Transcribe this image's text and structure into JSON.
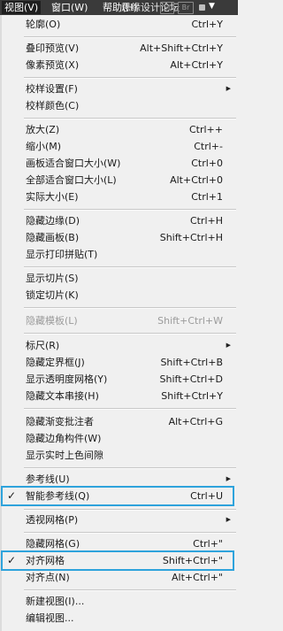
{
  "menubar": {
    "view": "视图(V)",
    "window": "窗口(W)",
    "help": "帮助(H)",
    "watermark": "思缘设计论坛",
    "icon_st": "St",
    "icon_br": "Br"
  },
  "colors": {
    "menubar_bg": "#3a3a3a",
    "menu_bg": "#f0f0f0",
    "highlight": "#2ea3dc"
  },
  "menu": {
    "items": [
      {
        "label": "轮廓(O)",
        "shortcut": "Ctrl+Y"
      },
      {
        "label": "叠印预览(V)",
        "shortcut": "Alt+Shift+Ctrl+Y"
      },
      {
        "label": "像素预览(X)",
        "shortcut": "Alt+Ctrl+Y"
      },
      {
        "label": "校样设置(F)",
        "shortcut": ""
      },
      {
        "label": "校样颜色(C)",
        "shortcut": ""
      },
      {
        "label": "放大(Z)",
        "shortcut": "Ctrl++"
      },
      {
        "label": "缩小(M)",
        "shortcut": "Ctrl+-"
      },
      {
        "label": "画板适合窗口大小(W)",
        "shortcut": "Ctrl+0"
      },
      {
        "label": "全部适合窗口大小(L)",
        "shortcut": "Alt+Ctrl+0"
      },
      {
        "label": "实际大小(E)",
        "shortcut": "Ctrl+1"
      },
      {
        "label": "隐藏边缘(D)",
        "shortcut": "Ctrl+H"
      },
      {
        "label": "隐藏画板(B)",
        "shortcut": "Shift+Ctrl+H"
      },
      {
        "label": "显示打印拼贴(T)",
        "shortcut": ""
      },
      {
        "label": "显示切片(S)",
        "shortcut": ""
      },
      {
        "label": "锁定切片(K)",
        "shortcut": ""
      },
      {
        "label": "隐藏模板(L)",
        "shortcut": "Shift+Ctrl+W"
      },
      {
        "label": "标尺(R)",
        "shortcut": ""
      },
      {
        "label": "隐藏定界框(J)",
        "shortcut": "Shift+Ctrl+B"
      },
      {
        "label": "显示透明度网格(Y)",
        "shortcut": "Shift+Ctrl+D"
      },
      {
        "label": "隐藏文本串接(H)",
        "shortcut": "Shift+Ctrl+Y"
      },
      {
        "label": "隐藏渐变批注者",
        "shortcut": "Alt+Ctrl+G"
      },
      {
        "label": "隐藏边角构件(W)",
        "shortcut": ""
      },
      {
        "label": "显示实时上色间隙",
        "shortcut": ""
      },
      {
        "label": "参考线(U)",
        "shortcut": ""
      },
      {
        "label": "智能参考线(Q)",
        "shortcut": "Ctrl+U"
      },
      {
        "label": "透视网格(P)",
        "shortcut": ""
      },
      {
        "label": "隐藏网格(G)",
        "shortcut": "Ctrl+\""
      },
      {
        "label": "对齐网格",
        "shortcut": "Shift+Ctrl+\""
      },
      {
        "label": "对齐点(N)",
        "shortcut": "Alt+Ctrl+\""
      },
      {
        "label": "新建视图(I)...",
        "shortcut": ""
      },
      {
        "label": "编辑视图...",
        "shortcut": ""
      }
    ]
  }
}
